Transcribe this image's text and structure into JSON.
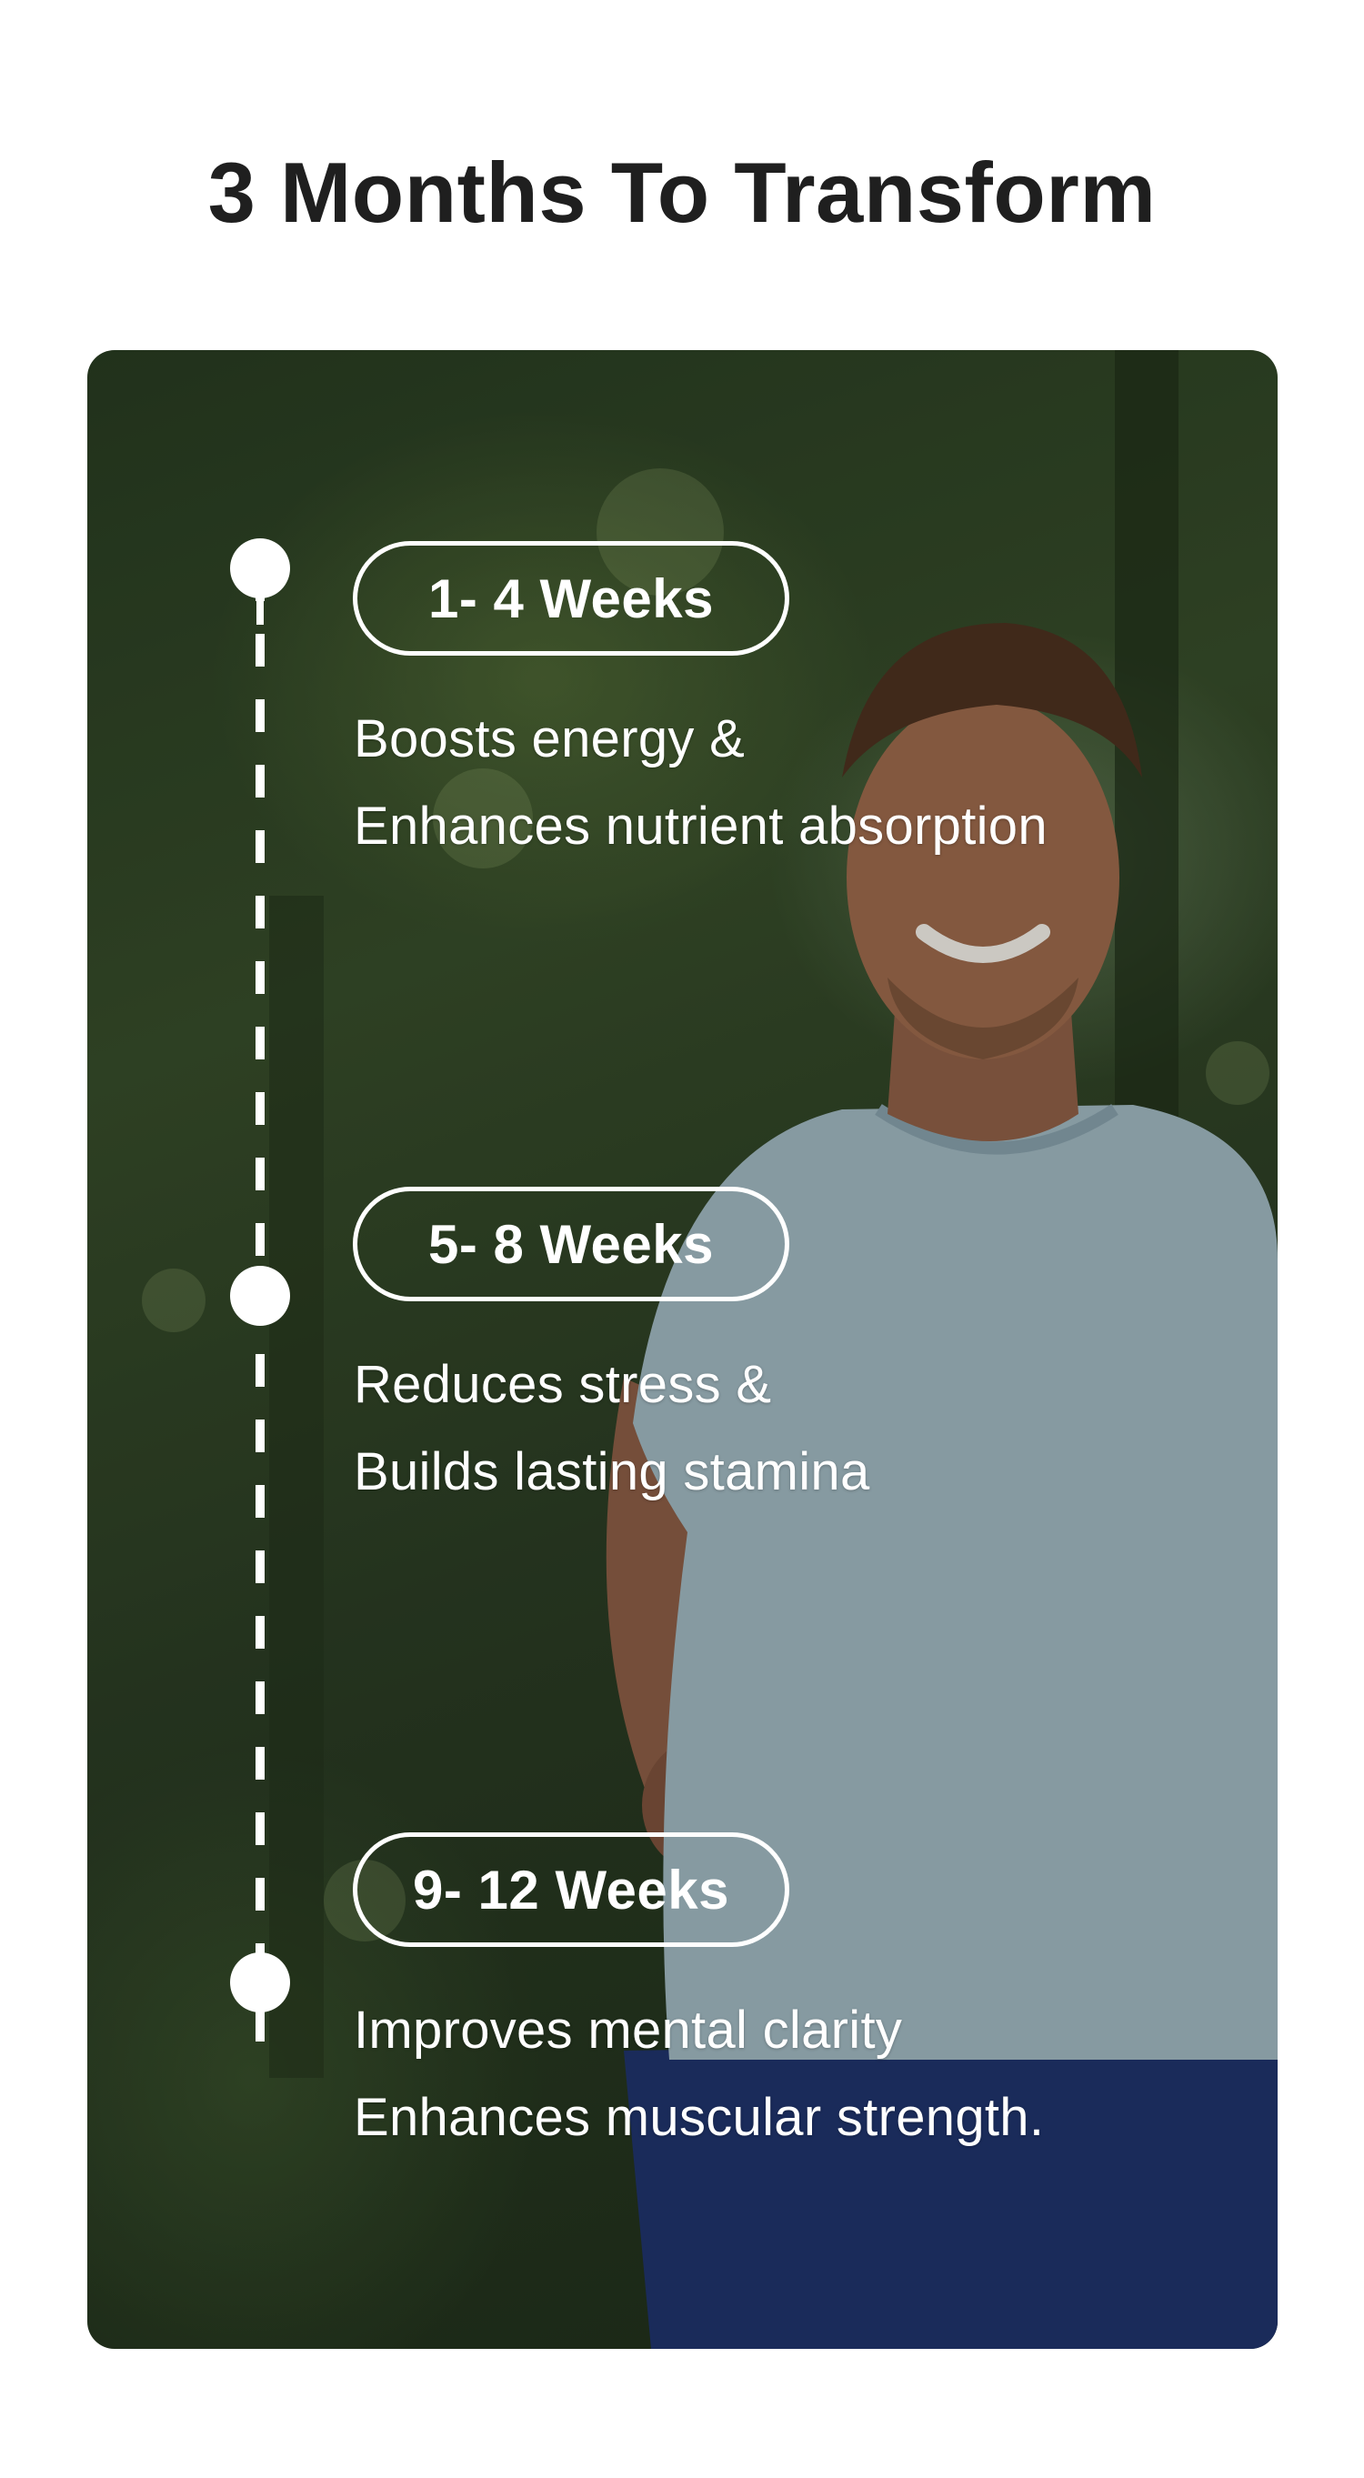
{
  "page": {
    "title": "3 Months To Transform"
  },
  "timeline": {
    "stages": [
      {
        "period": "1- 4 Weeks",
        "line1": "Boosts energy &",
        "line2": "Enhances nutrient absorption"
      },
      {
        "period": "5- 8 Weeks",
        "line1": "Reduces stress &",
        "line2": "Builds lasting stamina"
      },
      {
        "period": "9- 12 Weeks",
        "line1": "Improves mental clarity",
        "line2": "Enhances muscular strength."
      }
    ]
  },
  "colors": {
    "title": "#1f1f1f",
    "accent": "#ffffff",
    "forest": "#2f4423",
    "shirt": "#9fb6c0",
    "shorts": "#1c2f6a"
  },
  "image": {
    "icon": "running-man-photo"
  }
}
